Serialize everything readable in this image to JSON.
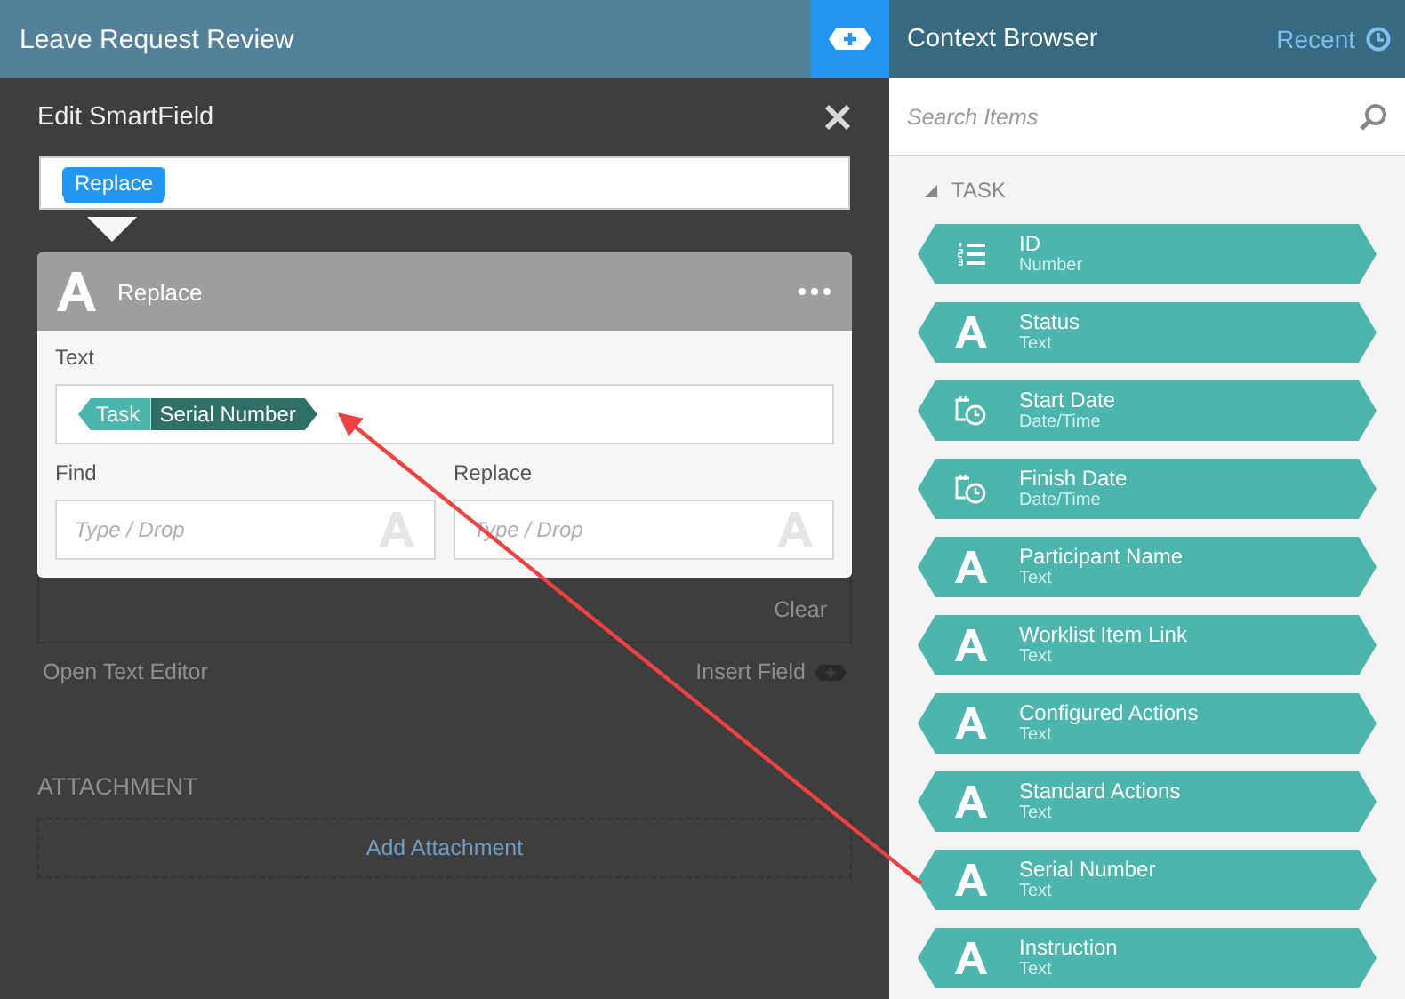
{
  "app_bar": {
    "title": "Leave Request Review"
  },
  "dialog": {
    "title": "Edit SmartField",
    "expression": {
      "chip": "Replace"
    },
    "function_card": {
      "title": "Replace",
      "text_label": "Text",
      "text_value": {
        "source": "Task",
        "field": "Serial Number"
      },
      "find": {
        "label": "Find",
        "placeholder": "Type / Drop"
      },
      "replace": {
        "label": "Replace",
        "placeholder": "Type / Drop"
      }
    }
  },
  "background_form": {
    "clear": "Clear",
    "open_text_editor": "Open Text Editor",
    "insert_field": "Insert Field",
    "section": "ATTACHMENT",
    "add_attachment": "Add Attachment"
  },
  "context_browser": {
    "title": "Context Browser",
    "recent": "Recent",
    "search": {
      "placeholder": "Search Items"
    },
    "group": {
      "label": "TASK",
      "expanded": true,
      "items": [
        {
          "name": "ID",
          "type_label": "Number",
          "kind": "number"
        },
        {
          "name": "Status",
          "type_label": "Text",
          "kind": "text"
        },
        {
          "name": "Start Date",
          "type_label": "Date/Time",
          "kind": "datetime"
        },
        {
          "name": "Finish Date",
          "type_label": "Date/Time",
          "kind": "datetime"
        },
        {
          "name": "Participant Name",
          "type_label": "Text",
          "kind": "text"
        },
        {
          "name": "Worklist Item Link",
          "type_label": "Text",
          "kind": "text"
        },
        {
          "name": "Configured Actions",
          "type_label": "Text",
          "kind": "text"
        },
        {
          "name": "Standard Actions",
          "type_label": "Text",
          "kind": "text"
        },
        {
          "name": "Serial Number",
          "type_label": "Text",
          "kind": "text"
        },
        {
          "name": "Instruction",
          "type_label": "Text",
          "kind": "text"
        }
      ]
    }
  }
}
